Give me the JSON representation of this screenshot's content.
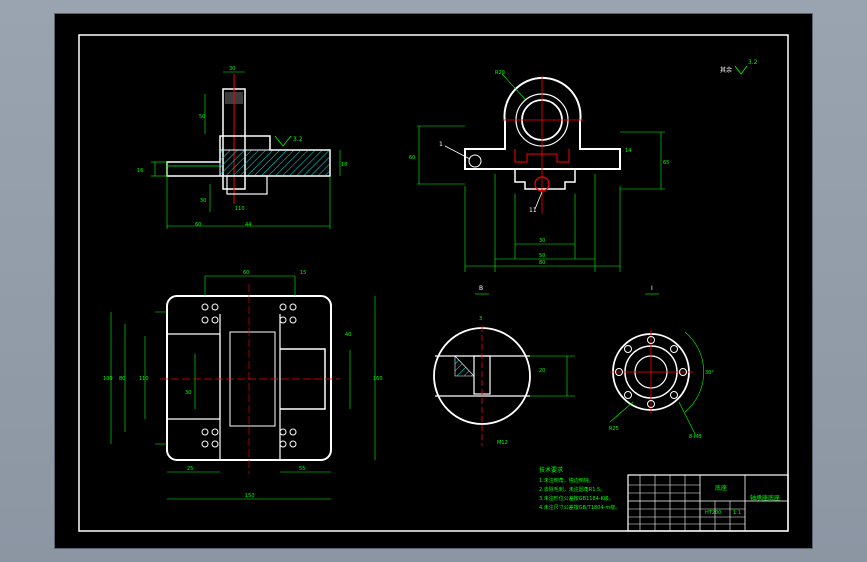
{
  "drawing": {
    "surface_roughness_note": "3.2",
    "colors": {
      "outline": "#ffffff",
      "dimension": "#00ff00",
      "centerline": "#ff0000",
      "hatch": "#00e5e5",
      "background": "#000000",
      "viewport": "#9aa4b0"
    },
    "top_left_view": {
      "roughness": "3.2",
      "dims": [
        "30",
        "50",
        "16",
        "18",
        "60",
        "44",
        "30",
        "110"
      ]
    },
    "front_view": {
      "label_1": "1",
      "label_11": "11",
      "dims": [
        "R20",
        "60",
        "65",
        "14",
        "30",
        "50",
        "80"
      ]
    },
    "plan_view": {
      "dims": [
        "60",
        "15",
        "100",
        "80",
        "160",
        "110",
        "30",
        "40",
        "25",
        "55",
        "150"
      ]
    },
    "detail_views": {
      "section_label": "B",
      "detail_label": "I",
      "dims": [
        "3",
        "20",
        "M12",
        "R25",
        "30°",
        "8-M8"
      ]
    },
    "notes": {
      "title": "技术要求",
      "lines": [
        "1.未注倒角，锐边倒钝。",
        "2.去除毛刺，未注圆角R1.5。",
        "3.未注形位公差按GB1184-K级。",
        "4.未注尺寸公差按GB/T1804-m级。"
      ]
    },
    "title_block": {
      "part_name": "底座",
      "drawing_title": "轴承座底座",
      "material": "HT200",
      "scale": "1:1"
    }
  }
}
